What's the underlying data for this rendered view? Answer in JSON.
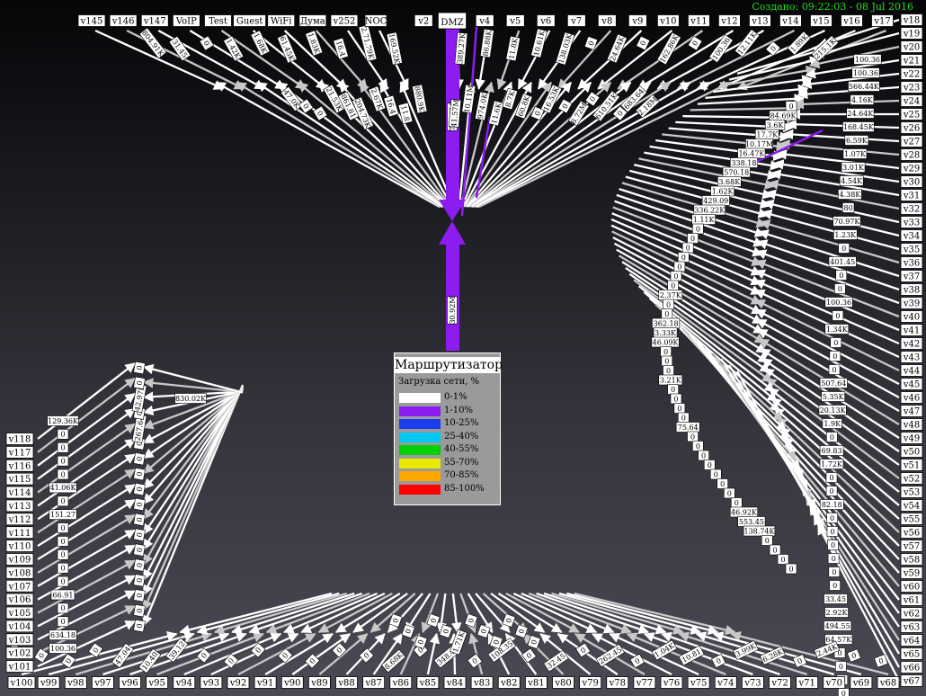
{
  "timestamp": "Создано: 09:22:03 - 08 Jul 2016",
  "router": {
    "label": "Маршрутизатор"
  },
  "legend": {
    "title": "Загрузка сети, %",
    "ranges": [
      {
        "label": "0-1%",
        "color": "#ffffff"
      },
      {
        "label": "1-10%",
        "color": "#8c1cf0"
      },
      {
        "label": "10-25%",
        "color": "#1c3cf0"
      },
      {
        "label": "25-40%",
        "color": "#00c8f0"
      },
      {
        "label": "40-55%",
        "color": "#00d000"
      },
      {
        "label": "55-70%",
        "color": "#e8e800"
      },
      {
        "label": "70-85%",
        "color": "#ffa500"
      },
      {
        "label": "85-100%",
        "color": "#ff0000"
      }
    ]
  },
  "dmz": {
    "name": "DMZ",
    "in_label": "77.73M",
    "out_label": "30.92M",
    "color": "#8c1cf0"
  },
  "top_nodes": [
    "v145",
    "v146",
    "v147",
    "VoIP",
    "Test",
    "Guest",
    "WiFi",
    "Дума",
    "v252",
    "NOC",
    "v2",
    "v3",
    "v4",
    "v5",
    "v6",
    "v7",
    "v8",
    "v9",
    "v10",
    "v11",
    "v12",
    "v13",
    "v14",
    "v15",
    "v16",
    "v17"
  ],
  "right_nodes": [
    "v18",
    "v19",
    "v20",
    "v21",
    "v22",
    "v23",
    "v24",
    "v25",
    "v26",
    "v27",
    "v28",
    "v29",
    "v30",
    "v31",
    "v32",
    "v33",
    "v34",
    "v35",
    "v36",
    "v37",
    "v38",
    "v39",
    "v40",
    "v41",
    "v42",
    "v43",
    "v44",
    "v45",
    "v46",
    "v47",
    "v48",
    "v49",
    "v50",
    "v51",
    "v52",
    "v53",
    "v54",
    "v55",
    "v56",
    "v57",
    "v58",
    "v59",
    "v60",
    "v61",
    "v62",
    "v63",
    "v64",
    "v65",
    "v66",
    "v67"
  ],
  "bottom_nodes": [
    "v68",
    "v69",
    "v70",
    "v71",
    "v72",
    "v73",
    "v74",
    "v75",
    "v76",
    "v77",
    "v78",
    "v79",
    "v80",
    "v81",
    "v82",
    "v83",
    "v84",
    "v85",
    "v86",
    "v87",
    "v88",
    "v89",
    "v90",
    "v91",
    "v92",
    "v93",
    "v94",
    "v95",
    "v96",
    "v97",
    "v98",
    "v99",
    "v100"
  ],
  "left_nodes": [
    "v101",
    "v102",
    "v103",
    "v104",
    "v105",
    "v106",
    "v107",
    "v108",
    "v109",
    "v110",
    "v111",
    "v112",
    "v113",
    "v114",
    "v115",
    "v116",
    "v117",
    "v118"
  ],
  "top_labels": [
    "804.91K",
    "31.45",
    "0",
    "1.42K",
    "1.68K",
    "61.45K",
    "1.83K",
    "16.4",
    "2.71.79K",
    "169.52K",
    "18.34M",
    "389.27K",
    "86.88K",
    "11.8K",
    "10.61K",
    "138.03K",
    "0",
    "24.64K",
    "0",
    "162.86K",
    "0",
    "100.36",
    "12.11K",
    "0",
    "1.89K",
    "215.1K"
  ],
  "top_labels_inner": [
    "47.0K",
    "0",
    "0",
    "21.53K",
    "861.81",
    "204.73K",
    "2.67K",
    "16.4",
    "11.8",
    "880.9K",
    "41.6M",
    "41.57M",
    "10.11M",
    "974.0K",
    "11.6K",
    "8.7K",
    "60.8K",
    "0",
    "16.53K",
    "0",
    "8.72M",
    "0",
    "610.51K",
    "0",
    "683.64",
    "2.18M"
  ],
  "right_labels_inner": [
    "100.36",
    "100.36",
    "566.44K",
    "4.16K",
    "24.64K",
    "168.45K",
    "6.59K",
    "1.07K",
    "3.01K",
    "4.54K",
    "4.38K",
    "80",
    "70.97K",
    "1.23K",
    "0",
    "401.45",
    "0",
    "0",
    "100.36",
    "0",
    "1.34K",
    "0",
    "0",
    "0",
    "507.64",
    "5.35K",
    "20.13K",
    "1.9K",
    "0",
    "69.83",
    "1.72K",
    "0",
    "0",
    "82.18",
    "0",
    "0",
    "0",
    "0",
    "0",
    "0",
    "33.45",
    "2.92K",
    "494.55",
    "64.57K",
    "0",
    "0",
    "0",
    "0",
    "0",
    "0"
  ],
  "right_labels_outer": [
    "0",
    "84.69K",
    "3.6K",
    "17.7K",
    "10.17M",
    "16.47K",
    "338.18",
    "570.18",
    "3.68K",
    "1.62K",
    "429.09",
    "336.22K",
    "1.11K",
    "0",
    "0",
    "0",
    "0",
    "0",
    "0",
    "0",
    "2.37K",
    "0",
    "0",
    "362.18",
    "3.33K",
    "46.09K",
    "0",
    "0",
    "0",
    "3.21K",
    "0",
    "0",
    "0",
    "0",
    "75.64",
    "0",
    "0",
    "0",
    "0",
    "0",
    "0",
    "0",
    "0",
    "46.92K",
    "553.45",
    "138.74K",
    "0",
    "0",
    "0",
    "0"
  ],
  "bottom_labels": [
    "0",
    "0",
    "2.44K",
    "0",
    "6.28K",
    "3.99K",
    "0",
    "10.81",
    "1.04K",
    "0",
    "262.45",
    "0",
    "32.45",
    "0",
    "108.35",
    "0",
    "348.41",
    "0",
    "8.68K",
    "0",
    "0",
    "0",
    "0",
    "0",
    "0",
    "0",
    "39.12",
    "10.40",
    "47.04",
    "0",
    "0",
    "0",
    "0"
  ],
  "bottom_labels_center": [
    "0",
    "0",
    "0",
    "0",
    "0",
    "1.71K",
    "0",
    "0",
    "0",
    "0",
    "0",
    "0"
  ],
  "left_labels_outer": [
    "100.36",
    "634.18",
    "0",
    "0",
    "66.91",
    "0",
    "0",
    "0",
    "0",
    "0",
    "151.27",
    "0",
    "41.06K",
    "0",
    "0",
    "0",
    "0",
    "129.36K"
  ],
  "left_labels_inner": [
    "0",
    "0",
    "0",
    "0",
    "0",
    "0",
    "0",
    "0",
    "0",
    "0",
    "0",
    "0",
    "0",
    "267.64",
    "0",
    "42.97K",
    "0",
    "0"
  ],
  "left_top_label": "830.02K"
}
